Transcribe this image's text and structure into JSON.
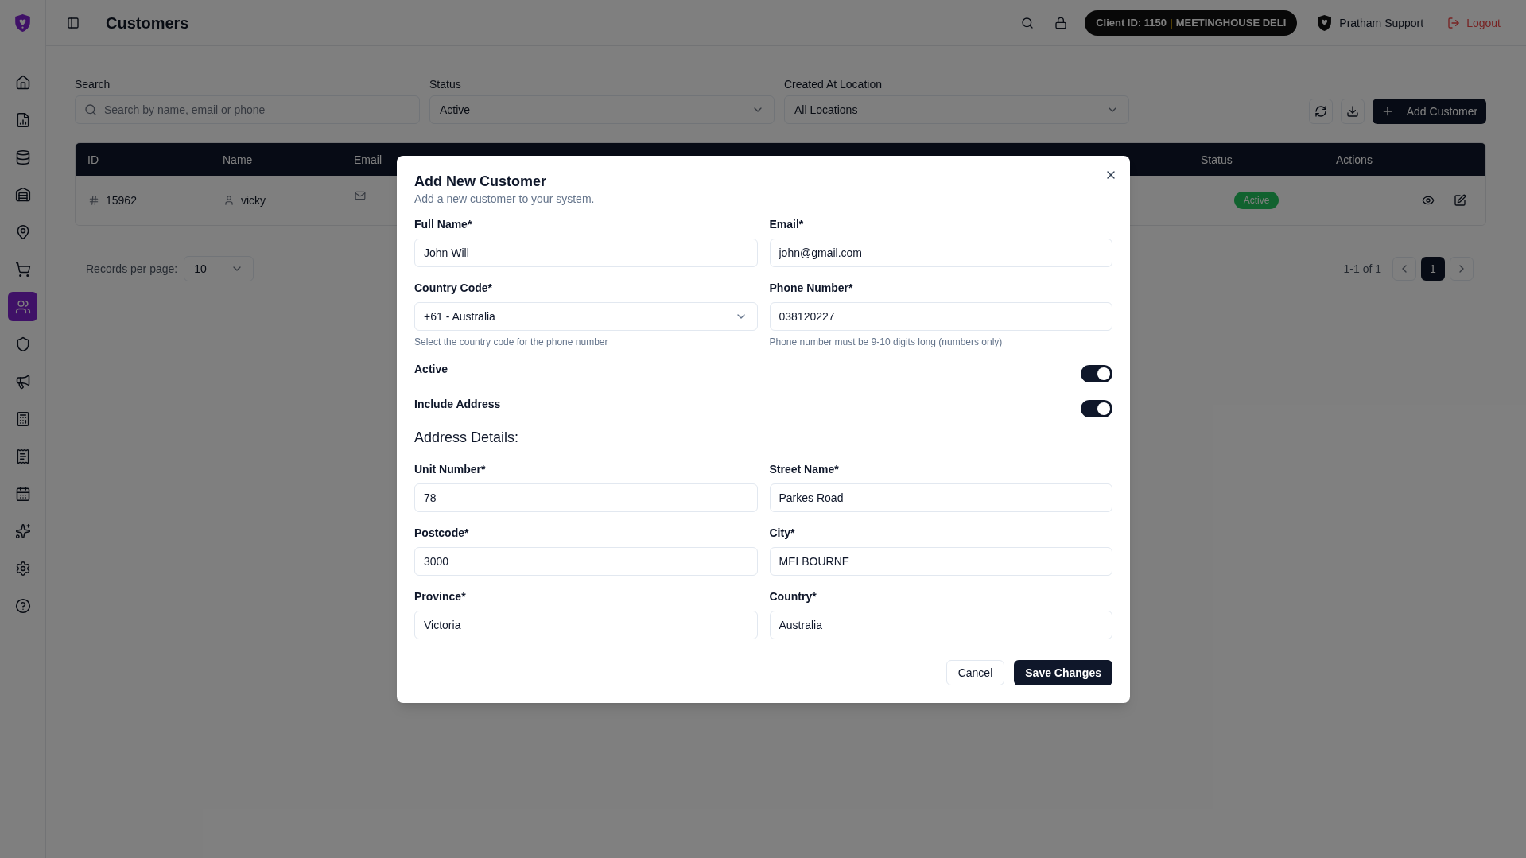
{
  "app": {
    "title": "Customers"
  },
  "topbar": {
    "client_id": "Client ID: 1150",
    "separator": "|",
    "client_name": "MEETINGHOUSE DELI",
    "user": "Pratham Support",
    "logout": "Logout"
  },
  "sidebar": {
    "items": [
      {
        "selected": false
      },
      {
        "selected": false
      },
      {
        "selected": false
      },
      {
        "selected": false
      },
      {
        "selected": false
      },
      {
        "selected": false
      },
      {
        "selected": true
      },
      {
        "selected": false
      },
      {
        "selected": false
      },
      {
        "selected": false
      },
      {
        "selected": false
      },
      {
        "selected": false
      },
      {
        "selected": false
      },
      {
        "selected": false
      },
      {
        "selected": false
      }
    ]
  },
  "filters": [
    {
      "kind": "search",
      "label": "Search",
      "placeholder": "Search by name, email or phone"
    },
    {
      "kind": "select",
      "label": "Status",
      "value": "Active"
    },
    {
      "kind": "select",
      "label": "Created At Location",
      "value": "All Locations"
    }
  ],
  "toolbar": {
    "add_button": "Add Customer"
  },
  "table": {
    "columns": [
      "ID",
      "Name",
      "Email",
      "Status",
      "Actions"
    ],
    "rows": [
      {
        "id": "15962",
        "name": "vicky",
        "status": "Active"
      }
    ]
  },
  "pagination": {
    "label": "Records per page:",
    "page_size": "10",
    "range": "1-1 of 1",
    "pages": [
      {
        "label": "1",
        "selected": true
      }
    ]
  },
  "modal": {
    "title": "Add New Customer",
    "subtitle": "Add a new customer to your system.",
    "fields": [
      {
        "kind": "text",
        "label": "Full Name*",
        "value": "John Will"
      },
      {
        "kind": "text",
        "label": "Email*",
        "value": "john@gmail.com"
      },
      {
        "kind": "select",
        "label": "Country Code*",
        "value": "+61 - Australia",
        "hint": "Select the country code for the phone number"
      },
      {
        "kind": "text",
        "label": "Phone Number*",
        "value": "038120227",
        "hint": "Phone number must be 9-10 digits long (numbers only)"
      }
    ],
    "switches": [
      {
        "label": "Active",
        "on": true
      },
      {
        "label": "Include Address",
        "on": true
      }
    ],
    "address": {
      "heading": "Address Details:",
      "fields": [
        {
          "kind": "text",
          "label": "Unit Number*",
          "value": "78"
        },
        {
          "kind": "text",
          "label": "Street Name*",
          "value": "Parkes Road"
        },
        {
          "kind": "text",
          "label": "Postcode*",
          "value": "3000"
        },
        {
          "kind": "text",
          "label": "City*",
          "value": "MELBOURNE"
        },
        {
          "kind": "text",
          "label": "Province*",
          "value": "Victoria"
        },
        {
          "kind": "text",
          "label": "Country*",
          "value": "Australia"
        }
      ]
    },
    "buttons": {
      "cancel": "Cancel",
      "save": "Save Changes"
    }
  }
}
